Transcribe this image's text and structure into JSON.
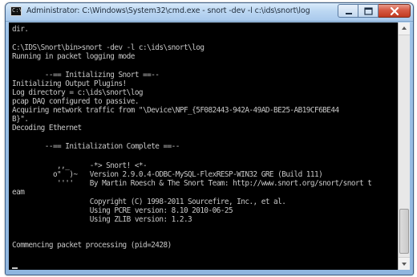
{
  "window": {
    "title": "Administrator: C:\\Windows\\System32\\cmd.exe - snort -dev -l c:\\ids\\snort\\log",
    "icon_text": "C:\\"
  },
  "console": {
    "lines": [
      "dir.",
      "",
      "C:\\IDS\\Snort\\bin>snort -dev -l c:\\ids\\snort\\log",
      "Running in packet logging mode",
      "",
      "        --== Initializing Snort ==--",
      "Initializing Output Plugins!",
      "Log directory = c:\\ids\\snort\\log",
      "pcap DAQ configured to passive.",
      "Acquiring network traffic from \"\\Device\\NPF_{5F082443-942A-49AD-BE25-AB19CF6BE44",
      "B}\".",
      "Decoding Ethernet",
      "",
      "        --== Initialization Complete ==--",
      "",
      "           ,,_     -*> Snort! <*-",
      "          o\"  )~   Version 2.9.0.4-ODBC-MySQL-FlexRESP-WIN32 GRE (Build 111)",
      "           ''''    By Martin Roesch & The Snort Team: http://www.snort.org/snort/snort t",
      "eam",
      "                   Copyright (C) 1998-2011 Sourcefire, Inc., et al.",
      "                   Using PCRE version: 8.10 2010-06-25",
      "                   Using ZLIB version: 1.2.3",
      "",
      "Commencing packet processing (pid=2428)"
    ]
  }
}
